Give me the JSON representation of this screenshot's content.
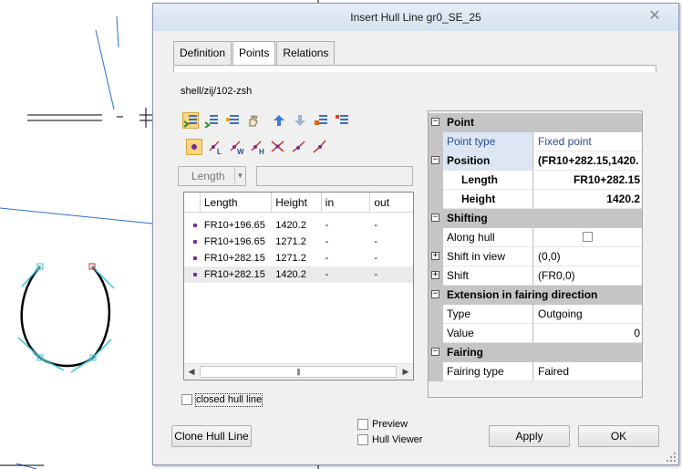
{
  "dialog": {
    "title": "Insert Hull Line gr0_SE_25",
    "tabs": [
      "Definition",
      "Points",
      "Relations"
    ],
    "active_tab": "Points",
    "path_label": "shell/zij/102-zsh",
    "toolbar_row1_icons": [
      "insert-point-icon",
      "append-point-icon",
      "insert-list-icon",
      "hand-icon",
      "move-up-icon",
      "move-down-icon",
      "delete-point-icon",
      "delete-list-icon"
    ],
    "toolbar_row2_icons": [
      "point-type-icon",
      "lines-L-icon",
      "lines-W-icon",
      "lines-H-icon",
      "intersection-icon",
      "tangent-icon",
      "knuckle-icon"
    ],
    "combo": {
      "value": "Length"
    },
    "table": {
      "columns": [
        "Length",
        "Height",
        "in",
        "out"
      ],
      "rows": [
        {
          "length": "FR10+196.65",
          "height": "1420.2",
          "in": "-",
          "out": "-"
        },
        {
          "length": "FR10+196.65",
          "height": "1271.2",
          "in": "-",
          "out": "-"
        },
        {
          "length": "FR10+282.15",
          "height": "1271.2",
          "in": "-",
          "out": "-"
        },
        {
          "length": "FR10+282.15",
          "height": "1420.2",
          "in": "-",
          "out": "-"
        }
      ],
      "selected_row": 3
    },
    "closed_hull_line": {
      "label": "closed hull line",
      "checked": false
    },
    "properties": {
      "cat_point": "Point",
      "point_type_key": "Point type",
      "point_type_val": "Fixed point",
      "position_key": "Position",
      "position_val": "(FR10+282.15,1420.",
      "length_key": "Length",
      "length_val": "FR10+282.15",
      "height_key": "Height",
      "height_val": "1420.2",
      "cat_shifting": "Shifting",
      "along_hull_key": "Along hull",
      "along_hull_checked": false,
      "shift_view_key": "Shift in view",
      "shift_view_val": "(0,0)",
      "shift_key": "Shift",
      "shift_val": "(FR0,0)",
      "cat_extension": "Extension in fairing direction",
      "type_key": "Type",
      "type_val": "Outgoing",
      "value_key": "Value",
      "value_val": "0",
      "cat_fairing": "Fairing",
      "fairing_type_key": "Fairing type",
      "fairing_type_val": "Faired"
    },
    "buttons": {
      "clone": "Clone Hull Line",
      "apply": "Apply",
      "ok": "OK"
    },
    "preview": {
      "label": "Preview",
      "checked": false
    },
    "hull_viewer": {
      "label": "Hull Viewer",
      "checked": false
    }
  },
  "colors": {
    "accent": "#2a4d8c",
    "title_bar": "#dfe8f3",
    "curve_cyan": "#39c6df",
    "row_marker": "#7a2a9a"
  }
}
